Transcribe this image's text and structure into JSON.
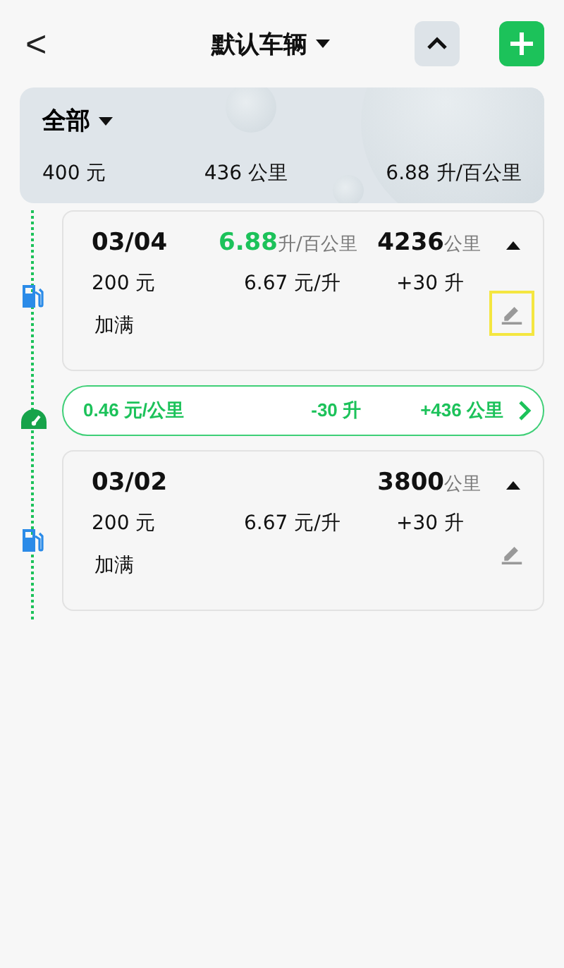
{
  "header": {
    "back": "<",
    "title": "默认车辆"
  },
  "summary": {
    "filter": "全部",
    "cost": "400 元",
    "distance": "436 公里",
    "consumption": "6.88 升/百公里"
  },
  "entries": [
    {
      "kind": "record",
      "date": "03/04",
      "consumption": "6.88",
      "consumption_unit": "升/百公里",
      "odometer": "4236",
      "odometer_unit": "公里",
      "cost": "200 元",
      "price": "6.67 元/升",
      "volume": "+30 升",
      "note": "加满",
      "highlighted": true
    },
    {
      "kind": "segment",
      "cost_per_km": "0.46 元/公里",
      "fuel": "-30 升",
      "distance": "+436 公里"
    },
    {
      "kind": "record",
      "date": "03/02",
      "odometer": "3800",
      "odometer_unit": "公里",
      "cost": "200 元",
      "price": "6.67 元/升",
      "volume": "+30 升",
      "note": "加满",
      "highlighted": false
    }
  ]
}
